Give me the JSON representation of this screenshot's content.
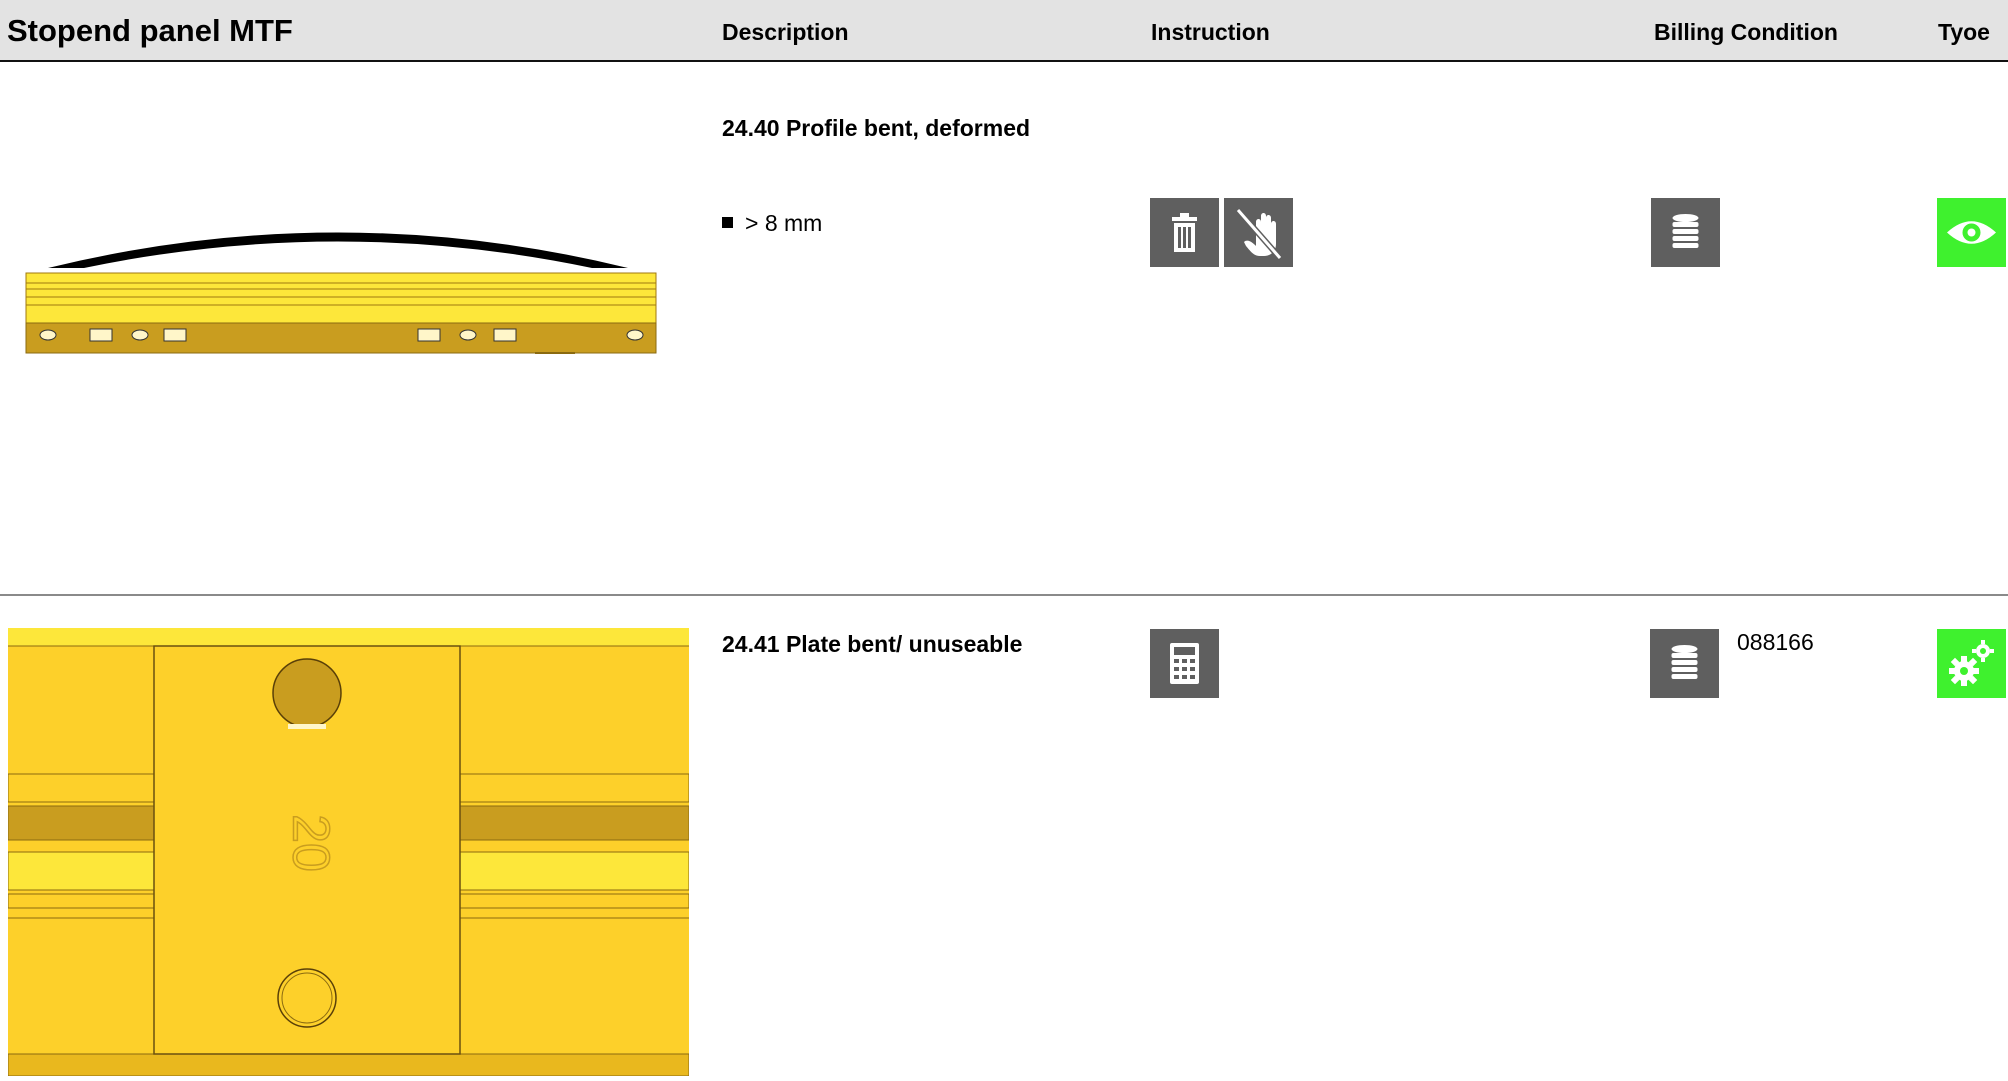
{
  "header": {
    "title": "Stopend panel MTF",
    "col_description": "Description",
    "col_instruction": "Instruction",
    "col_billing": "Billing Condition",
    "col_type": "Tyoe"
  },
  "rows": [
    {
      "title": "24.40 Profile bent,  deformed",
      "bullet": "> 8 mm",
      "instruction_icons": [
        "trash-icon",
        "no-touch-hand-icon"
      ],
      "billing_icon": "coins-stack-icon",
      "billing_code": "",
      "type_icon": "eye-icon"
    },
    {
      "title": "24.41 Plate bent/ unuseable",
      "instruction_icons": [
        "calculator-icon"
      ],
      "billing_icon": "coins-stack-icon",
      "billing_code": "088166",
      "type_icon": "gears-icon"
    }
  ],
  "figure_2": {
    "stamp_text": "20"
  },
  "colors": {
    "header_bg": "#e3e3e3",
    "icon_gray": "#5f5f5f",
    "icon_green": "#3ff12e",
    "profile_yellow": "#fdd02a",
    "profile_dark": "#c99d1f"
  }
}
